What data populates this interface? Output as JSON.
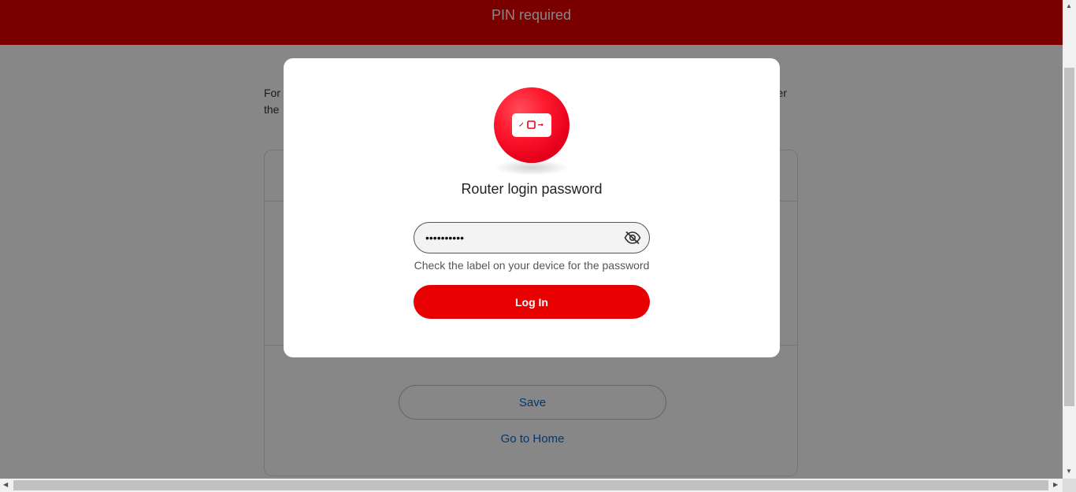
{
  "header": {
    "title": "PIN required"
  },
  "page": {
    "intro_left_fragment_1": "For",
    "intro_left_fragment_2": "the",
    "intro_right_fragment": "er",
    "save_label": "Save",
    "home_label": "Go to Home"
  },
  "modal": {
    "title": "Router login password",
    "password_value": "••••••••••",
    "hint": "Check the label on your device for the password",
    "login_label": "Log In",
    "logo_icon": "router-icon",
    "toggle_icon": "eye-off-icon"
  },
  "colors": {
    "brand": "#e60000",
    "link": "#0b66d9"
  }
}
